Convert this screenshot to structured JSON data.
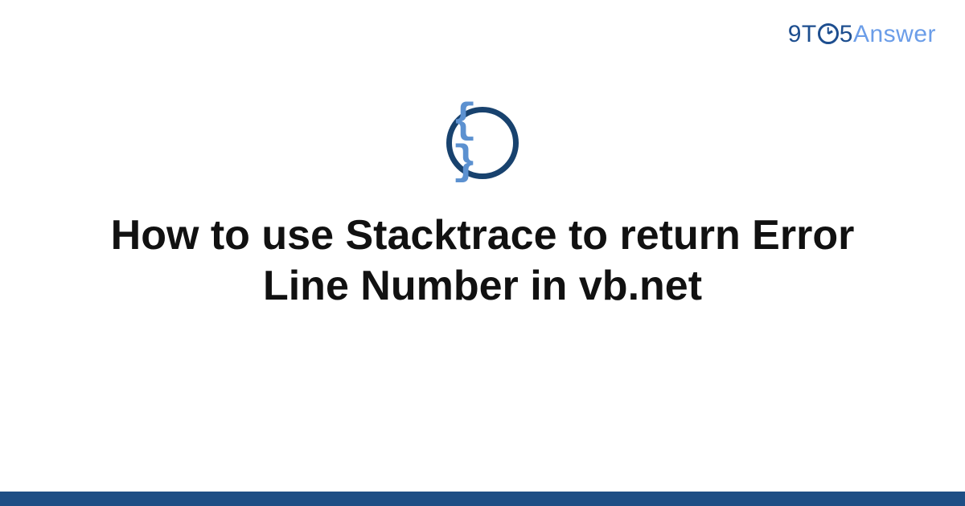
{
  "logo": {
    "part1": "9T",
    "part2": "5",
    "part3": "Answer"
  },
  "icon": {
    "glyph": "{ }",
    "name": "code-braces"
  },
  "title": "How to use Stacktrace to return Error Line Number in vb.net",
  "colors": {
    "ring": "#18426e",
    "brace": "#5c91d0",
    "footer": "#1e4e85",
    "logo_dark": "#1d4e8f",
    "logo_light": "#6b9de8"
  }
}
